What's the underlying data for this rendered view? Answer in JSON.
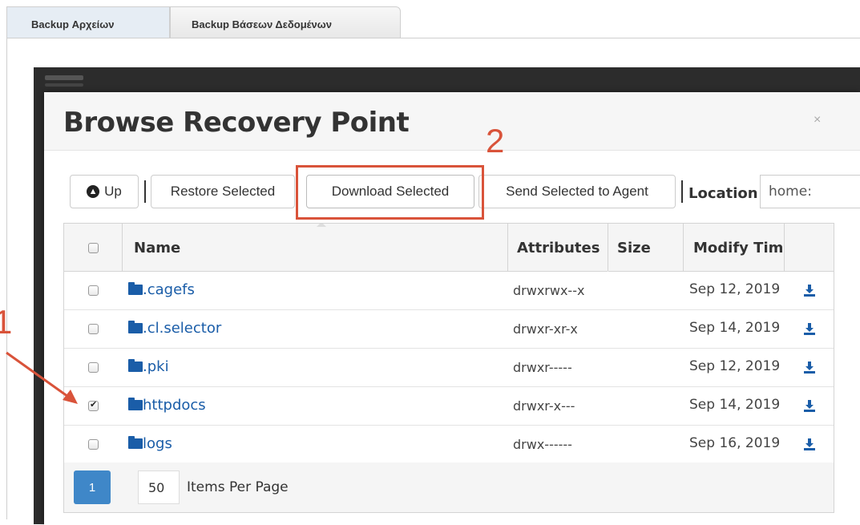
{
  "tabs": [
    {
      "label": "Backup Αρχείων"
    },
    {
      "label": "Backup Βάσεων Δεδομένων"
    }
  ],
  "modal": {
    "title": "Browse Recovery Point",
    "close": "×"
  },
  "toolbar": {
    "up_label": "Up",
    "restore_label": "Restore Selected",
    "download_label": "Download Selected",
    "send_label": "Send Selected to Agent",
    "location_label": "Location",
    "location_value": "home:"
  },
  "table": {
    "headers": {
      "name": "Name",
      "attributes": "Attributes",
      "size": "Size",
      "modify_time": "Modify Tim"
    },
    "rows": [
      {
        "name": ".cagefs",
        "attributes": "drwxrwx--x",
        "size": "",
        "modified": "Sep 12, 2019",
        "checked": false
      },
      {
        "name": ".cl.selector",
        "attributes": "drwxr-xr-x",
        "size": "",
        "modified": "Sep 14, 2019",
        "checked": false
      },
      {
        "name": ".pki",
        "attributes": "drwxr-----",
        "size": "",
        "modified": "Sep 12, 2019",
        "checked": false
      },
      {
        "name": "httpdocs",
        "attributes": "drwxr-x---",
        "size": "",
        "modified": "Sep 14, 2019",
        "checked": true
      },
      {
        "name": "logs",
        "attributes": "drwx------",
        "size": "",
        "modified": "Sep 16, 2019",
        "checked": false
      }
    ]
  },
  "pagination": {
    "current_page": "1",
    "items_per_page": "50",
    "items_per_page_label": "Items Per Page"
  },
  "annotations": {
    "step1": "1",
    "step2": "2",
    "color": "#d9533a"
  },
  "colors": {
    "link": "#1a5da8",
    "page_button": "#3f87c8",
    "active_tab": "#e6edf4"
  }
}
